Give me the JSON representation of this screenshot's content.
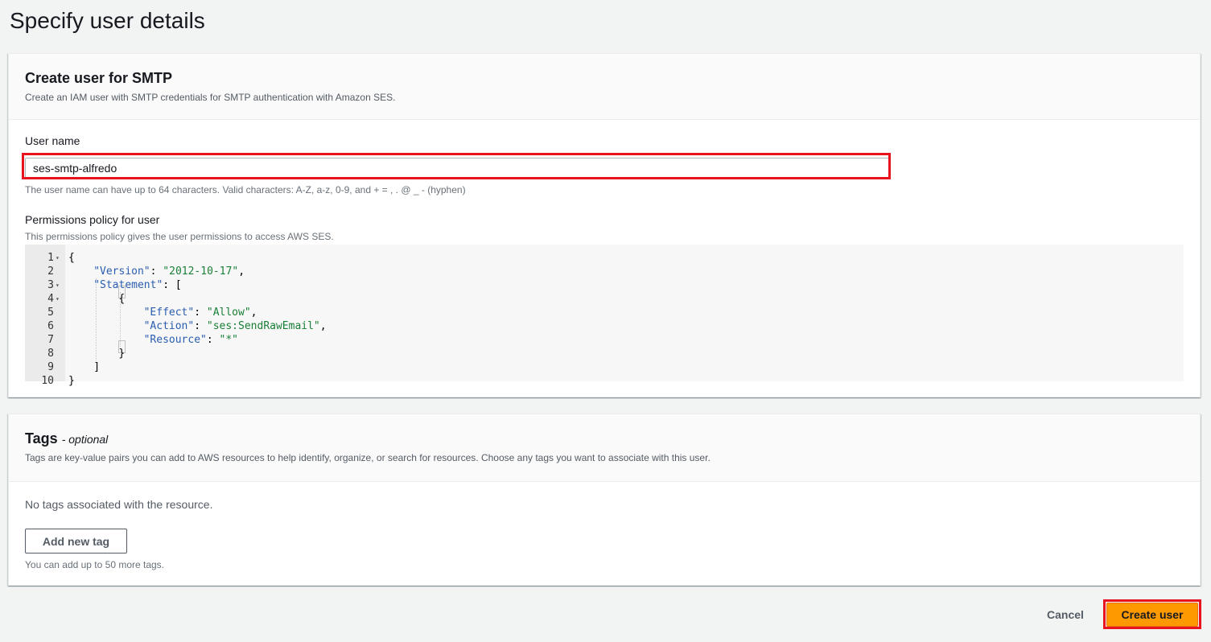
{
  "page": {
    "title": "Specify user details"
  },
  "smtp_panel": {
    "title": "Create user for SMTP",
    "description": "Create an IAM user with SMTP credentials for SMTP authentication with Amazon SES.",
    "username_label": "User name",
    "username_value": "ses-smtp-alfredo",
    "username_hint": "The user name can have up to 64 characters. Valid characters: A-Z, a-z, 0-9, and + = , . @ _ - (hyphen)",
    "policy_label": "Permissions policy for user",
    "policy_hint": "This permissions policy gives the user permissions to access AWS SES.",
    "policy_lines": [
      {
        "num": "1",
        "fold": true,
        "indent": 0,
        "tokens": [
          {
            "t": "{",
            "c": "p"
          }
        ]
      },
      {
        "num": "2",
        "fold": false,
        "indent": 1,
        "tokens": [
          {
            "t": "\"Version\"",
            "c": "k"
          },
          {
            "t": ": ",
            "c": "p"
          },
          {
            "t": "\"2012-10-17\"",
            "c": "s"
          },
          {
            "t": ",",
            "c": "p"
          }
        ]
      },
      {
        "num": "3",
        "fold": true,
        "indent": 1,
        "tokens": [
          {
            "t": "\"Statement\"",
            "c": "k"
          },
          {
            "t": ": [",
            "c": "p"
          }
        ]
      },
      {
        "num": "4",
        "fold": true,
        "indent": 2,
        "tokens": [
          {
            "t": "{",
            "c": "p"
          }
        ]
      },
      {
        "num": "5",
        "fold": false,
        "indent": 3,
        "tokens": [
          {
            "t": "\"Effect\"",
            "c": "k"
          },
          {
            "t": ": ",
            "c": "p"
          },
          {
            "t": "\"Allow\"",
            "c": "s"
          },
          {
            "t": ",",
            "c": "p"
          }
        ]
      },
      {
        "num": "6",
        "fold": false,
        "indent": 3,
        "tokens": [
          {
            "t": "\"Action\"",
            "c": "k"
          },
          {
            "t": ": ",
            "c": "p"
          },
          {
            "t": "\"ses:SendRawEmail\"",
            "c": "s"
          },
          {
            "t": ",",
            "c": "p"
          }
        ]
      },
      {
        "num": "7",
        "fold": false,
        "indent": 3,
        "tokens": [
          {
            "t": "\"Resource\"",
            "c": "k"
          },
          {
            "t": ": ",
            "c": "p"
          },
          {
            "t": "\"*\"",
            "c": "s"
          }
        ]
      },
      {
        "num": "8",
        "fold": false,
        "indent": 2,
        "tokens": [
          {
            "t": "}",
            "c": "p"
          }
        ]
      },
      {
        "num": "9",
        "fold": false,
        "indent": 1,
        "tokens": [
          {
            "t": "]",
            "c": "p"
          }
        ]
      },
      {
        "num": "10",
        "fold": false,
        "indent": 0,
        "tokens": [
          {
            "t": "}",
            "c": "p"
          }
        ]
      }
    ]
  },
  "tags_panel": {
    "title": "Tags",
    "title_suffix": "- optional",
    "description": "Tags are key-value pairs you can add to AWS resources to help identify, organize, or search for resources. Choose any tags you want to associate with this user.",
    "empty_text": "No tags associated with the resource.",
    "add_button": "Add new tag",
    "hint": "You can add up to 50 more tags."
  },
  "footer": {
    "cancel_label": "Cancel",
    "create_label": "Create user"
  },
  "colors": {
    "primary_button": "#ff9900",
    "annotation_highlight": "#e8131f"
  }
}
